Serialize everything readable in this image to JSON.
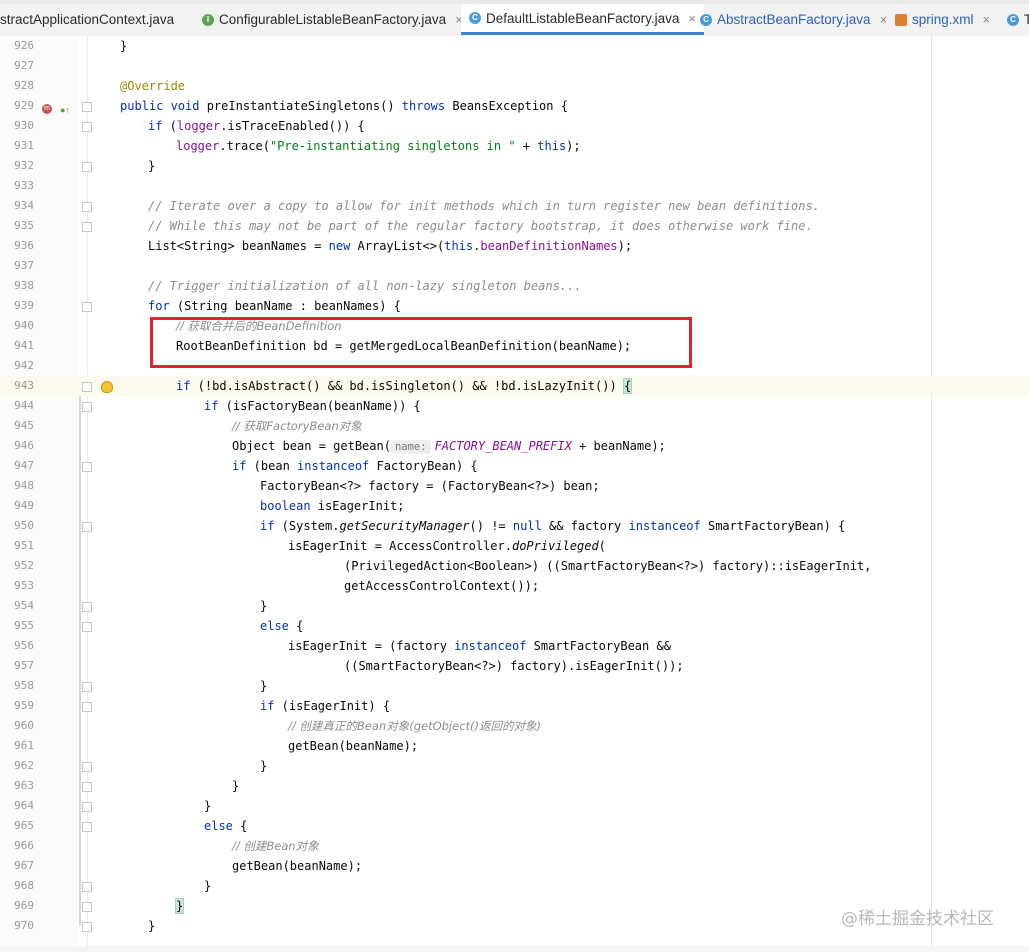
{
  "tabs": [
    {
      "label": "stractApplicationContext.java",
      "icon": "class-icon",
      "active": false
    },
    {
      "label": "ConfigurableListableBeanFactory.java",
      "icon": "interface-icon",
      "active": false
    },
    {
      "label": "DefaultListableBeanFactory.java",
      "icon": "class-icon",
      "active": true
    },
    {
      "label": "AbstractBeanFactory.java",
      "icon": "class-icon",
      "active": false
    },
    {
      "label": "spring.xml",
      "icon": "xml-icon",
      "active": false
    },
    {
      "label": "T",
      "icon": "class-icon",
      "active": false
    }
  ],
  "tab_close_glyph": "×",
  "line_numbers": [
    "926",
    "927",
    "928",
    "929",
    "930",
    "931",
    "932",
    "933",
    "934",
    "935",
    "936",
    "937",
    "938",
    "939",
    "940",
    "941",
    "942",
    "943",
    "944",
    "945",
    "946",
    "947",
    "948",
    "949",
    "950",
    "951",
    "952",
    "953",
    "954",
    "955",
    "956",
    "957",
    "958",
    "959",
    "960",
    "961",
    "962",
    "963",
    "964",
    "965",
    "966",
    "967",
    "968",
    "969",
    "970"
  ],
  "code": {
    "l926": "}",
    "l928": "@Override",
    "l929_kw": "public void",
    "l929_rest": " preInstantiateSingletons() ",
    "l929_kw2": "throws",
    "l929_end": " BeansException {",
    "l930_kw": "if",
    "l930_a": " (",
    "l930_fld": "logger",
    "l930_b": ".isTraceEnabled()) {",
    "l931_fld": "logger",
    "l931_a": ".trace(",
    "l931_str": "\"Pre-instantiating singletons in \"",
    "l931_b": " + ",
    "l931_kw": "this",
    "l931_c": ");",
    "l932": "}",
    "l934": "// Iterate over a copy to allow for init methods which in turn register new bean definitions.",
    "l935": "// While this may not be part of the regular factory bootstrap, it does otherwise work fine.",
    "l936_a": "List<String> beanNames = ",
    "l936_kw": "new",
    "l936_b": " ArrayList<>(",
    "l936_kw2": "this",
    "l936_c": ".",
    "l936_fld": "beanDefinitionNames",
    "l936_d": ");",
    "l938": "// Trigger initialization of all non-lazy singleton beans...",
    "l939_kw": "for",
    "l939_a": " (String beanName : beanNames) {",
    "l940": "// 获取合并后的BeanDefinition",
    "l941": "RootBeanDefinition bd = getMergedLocalBeanDefinition(beanName);",
    "l943_kw": "if",
    "l943_a": " (!bd.isAbstract() && bd.isSingleton() && !bd.isLazyInit()) ",
    "l943_brace": "{",
    "l944_kw": "if",
    "l944_a": " (isFactoryBean(beanName)) {",
    "l945": "// 获取FactoryBean对象",
    "l946_a": "Object bean = getBean(",
    "l946_hint": "name:",
    "l946_cst": "FACTORY_BEAN_PREFIX",
    "l946_b": " + beanName);",
    "l947_kw": "if",
    "l947_a": " (bean ",
    "l947_kw2": "instanceof",
    "l947_b": " FactoryBean) {",
    "l948": "FactoryBean<?> factory = (FactoryBean<?>) bean;",
    "l949_kw": "boolean",
    "l949_a": " isEagerInit;",
    "l950_kw": "if",
    "l950_a": " (System.",
    "l950_st": "getSecurityManager",
    "l950_b": "() != ",
    "l950_kw2": "null",
    "l950_c": " && factory ",
    "l950_kw3": "instanceof",
    "l950_d": " SmartFactoryBean) {",
    "l951_a": "isEagerInit = AccessController.",
    "l951_st": "doPrivileged",
    "l951_b": "(",
    "l952": "(PrivilegedAction<Boolean>) ((SmartFactoryBean<?>) factory)::isEagerInit,",
    "l953": "getAccessControlContext());",
    "l954": "}",
    "l955_kw": "else",
    "l955_a": " {",
    "l956_a": "isEagerInit = (factory ",
    "l956_kw": "instanceof",
    "l956_b": " SmartFactoryBean &&",
    "l957": "((SmartFactoryBean<?>) factory).isEagerInit());",
    "l958": "}",
    "l959_kw": "if",
    "l959_a": " (isEagerInit) {",
    "l960": "// 创建真正的Bean对象(getObject()返回的对象)",
    "l961": "getBean(beanName);",
    "l962": "}",
    "l963": "}",
    "l964": "}",
    "l965_kw": "else",
    "l965_a": " {",
    "l966": "// 创建Bean对象",
    "l967": "getBean(beanName);",
    "l968": "}",
    "l969": "}",
    "l970": "}"
  },
  "gutter_icons": {
    "override": "m",
    "implements": "●↑"
  },
  "watermark": "@稀土掘金技术社区",
  "colors": {
    "keyword": "#0033b3",
    "field": "#871094",
    "string": "#067d17",
    "comment": "#8c8c8c",
    "annotation": "#9e880d",
    "highlight_box": "#d9252b",
    "active_tab_underline": "#4083c9"
  }
}
